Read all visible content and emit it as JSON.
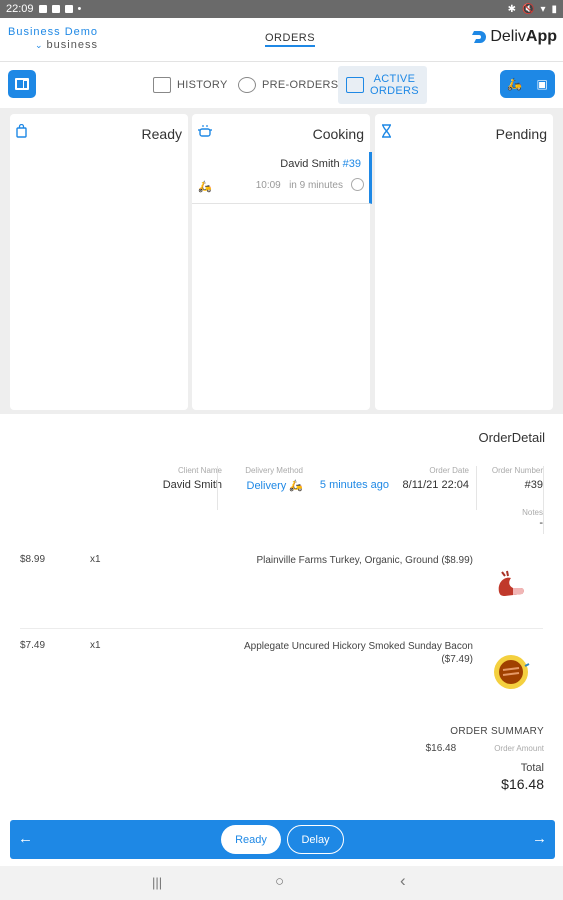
{
  "statusbar": {
    "time": "22:09",
    "dot": "•"
  },
  "header": {
    "business_name": "Business Demo",
    "business_sub": "business",
    "nav_orders": "ORDERS",
    "brand_pre": "Deliv",
    "brand_post": "App"
  },
  "tabs": [
    {
      "label": "HISTORY",
      "icon": "history-box-icon"
    },
    {
      "label": "PRE-ORDERS",
      "icon": "clock-box-icon"
    },
    {
      "label_line1": "ACTIVE",
      "label_line2": "ORDERS",
      "icon": "active-orders-icon"
    }
  ],
  "columns": [
    {
      "title": "Ready",
      "icon": "bag-icon"
    },
    {
      "title": "Cooking",
      "icon": "pot-icon"
    },
    {
      "title": "Pending",
      "icon": "hourglass-icon"
    }
  ],
  "cooking_order": {
    "name": "David Smith",
    "number": "#39",
    "time": "10:09",
    "eta": "in 9 minutes"
  },
  "detail": {
    "title": "OrderDetail",
    "client_name_label": "Client Name",
    "client_name": "David Smith",
    "delivery_method_label": "Delivery Method",
    "delivery_method": "Delivery",
    "ago": "5 minutes ago",
    "order_date_label": "Order Date",
    "order_date": "8/11/21 22:04",
    "order_number_label": "Order Number",
    "order_number": "#39",
    "notes_label": "Notes",
    "notes": "-"
  },
  "items": [
    {
      "price": "$8.99",
      "qty": "x1",
      "name": "Plainville Farms Turkey, Organic, Ground ($8.99)"
    },
    {
      "price": "$7.49",
      "qty": "x1",
      "name": "Applegate Uncured Hickory Smoked Sunday Bacon ($7.49)"
    }
  ],
  "summary": {
    "header": "ORDER SUMMARY",
    "amount": "$16.48",
    "amount_label": "Order Amount",
    "total_label": "Total",
    "total": "$16.48"
  },
  "actions": {
    "ready": "Ready",
    "delay": "Delay",
    "prev": "←",
    "next": "→"
  },
  "android_nav": {
    "recent": "|||",
    "home": "○",
    "back": "‹"
  },
  "colors": {
    "accent": "#1e88e5",
    "board_bg": "#eeeeee"
  }
}
